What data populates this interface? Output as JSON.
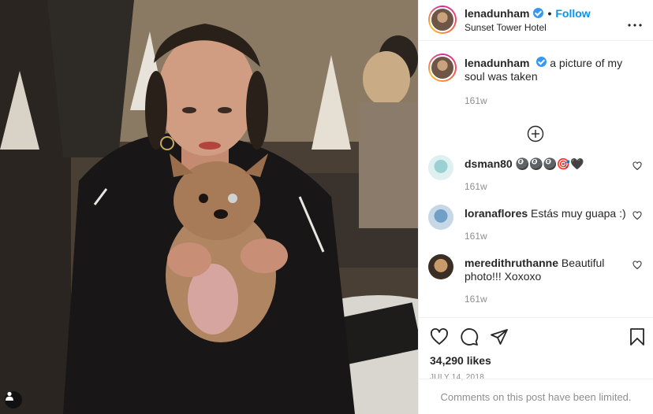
{
  "post": {
    "username": "lenadunham",
    "follow_label": "Follow",
    "separator": "•",
    "location": "Sunset Tower Hotel",
    "more_icon": "more-horizontal-icon"
  },
  "caption": {
    "username": "lenadunham",
    "text": "a picture of my soul was taken",
    "time": "161w"
  },
  "load_more_icon": "plus-circle-icon",
  "comments": [
    {
      "username": "dsman80",
      "text": "🎱🎱🎱🎯🖤",
      "time": "161w"
    },
    {
      "username": "loranaflores",
      "text": "Estás muy guapa :)",
      "time": "161w"
    },
    {
      "username": "meredithruthanne",
      "text": "Beautiful photo!!! Xoxoxo",
      "time": "161w"
    }
  ],
  "actions": {
    "likes": "34,290 likes",
    "date": "JULY 14, 2018",
    "comments_limited": "Comments on this post have been limited."
  },
  "colors": {
    "link": "#0095f6",
    "verified": "#3897f0",
    "muted": "#8e8e8e",
    "text": "#262626"
  }
}
